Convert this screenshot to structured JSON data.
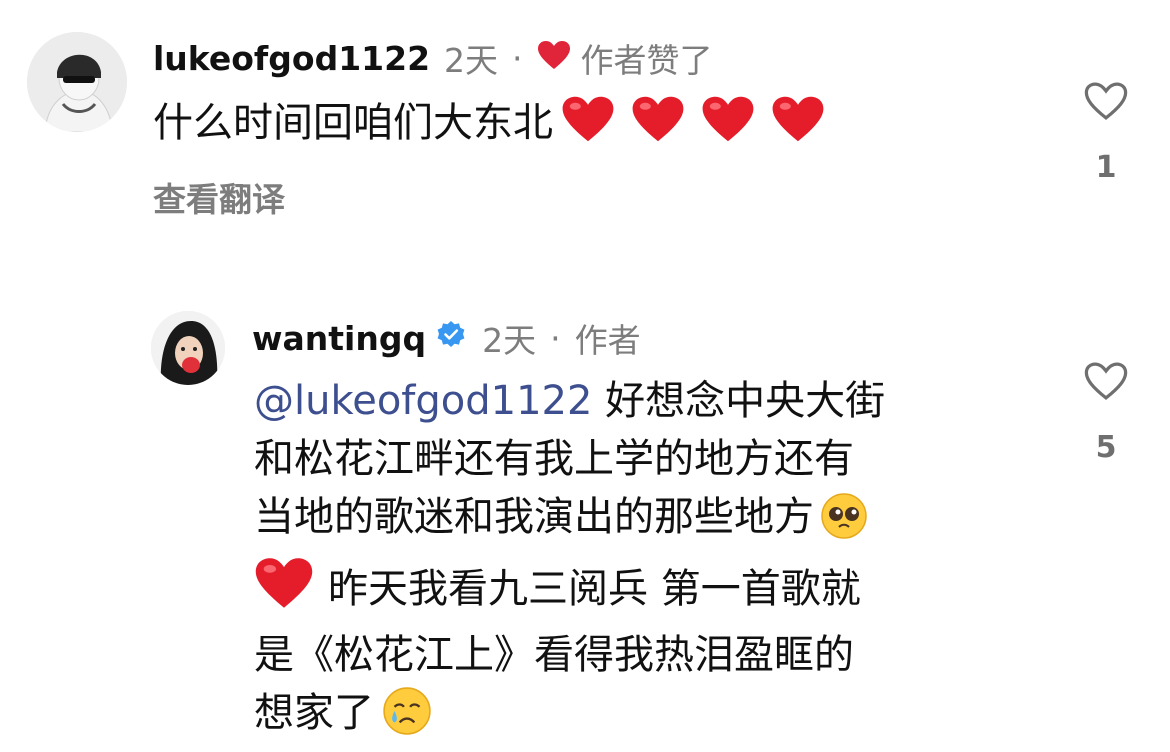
{
  "comments": [
    {
      "username": "lukeofgod1122",
      "time": "2天",
      "separator": "·",
      "author_liked": "作者赞了",
      "text": "什么时间回咱们大东北",
      "translate": "查看翻译",
      "like_count": "1",
      "colors": {
        "heart": "#e0253a",
        "username": "#111111",
        "meta": "#7d7d7d"
      }
    },
    {
      "username": "wantingq",
      "time": "2天",
      "separator": "·",
      "author_badge": "作者",
      "mention": "@lukeofgod1122",
      "lines": [
        "好想念中央大街",
        "和松花江畔还有我上学的地方还有",
        "当地的歌迷和我演出的那些地方",
        "昨天我看九三阅兵 第一首歌就",
        "是《松花江上》看得我热泪盈眶的",
        "想家了"
      ],
      "like_count": "5",
      "colors": {
        "mention": "#3d4f8f",
        "verified": "#3897f0"
      }
    }
  ]
}
